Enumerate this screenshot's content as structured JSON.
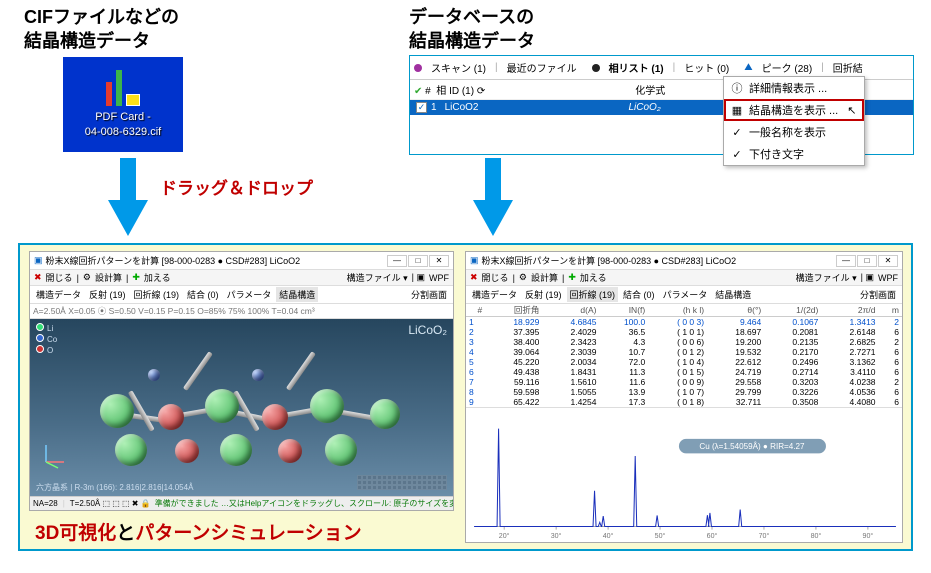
{
  "headings": {
    "cif": [
      "CIFファイルなどの",
      "結晶構造データ"
    ],
    "db": [
      "データベースの",
      "結晶構造データ"
    ]
  },
  "cif_icon": {
    "line1": "PDF Card -",
    "line2": "04-008-6329.cif"
  },
  "drag_drop": "ドラッグ＆ドロップ",
  "db_panel": {
    "tabs": {
      "scan": "スキャン (1)",
      "recent": "最近のファイル",
      "phaselist": "相リスト (1)",
      "hit": "ヒット (0)",
      "peak": "ピーク (28)",
      "diff": "回折結"
    },
    "sub": {
      "phaseid": "相 ID (1)",
      "formula": "化学式"
    },
    "row": {
      "idx": "1",
      "name": "LiCoO2",
      "formula": "LiCoO₂"
    }
  },
  "ctx_menu": {
    "detail": "詳細情報表示 ...",
    "show_struct": "結晶構造を表示 ...",
    "show_name": "一般名称を表示",
    "subscript": "下付き文字"
  },
  "window": {
    "title": "粉末X線回折パターンを計算 [98-000-0283 ● CSD#283] LiCoO2",
    "toolbar": {
      "open": "開じる",
      "save": "設計算",
      "add": "加える",
      "structfile": "構造ファイル ▾",
      "wpf": "WPF"
    },
    "tabs": {
      "struct": "構造データ",
      "refl": "反射 (19)",
      "diff": "回折線 (19)",
      "bond": "結合 (0)",
      "param": "パラメータ",
      "crys": "結晶構造"
    },
    "split": "分割画面",
    "params3d": "A=2.50Å  X=0.05  ⦿ S=0.50  V=0.15  P=0.15  O=85%  75%  100%  T=0.04  cm³",
    "formula": "LiCoO₂",
    "legend": {
      "li": "Li",
      "co": "Co",
      "o": "O"
    },
    "crysinfo": "六方晶系 | R-3m (166): 2.816|2.816|14.054Å",
    "status": {
      "na": "NA=28",
      "t": "T=2.50Å",
      "ready": "準備ができました …又はHelpアイコンをドラッグし、スクロール: 原子のサイズを変更…"
    }
  },
  "refl_table": {
    "headers": [
      "#",
      "回折角",
      "d(A)",
      "IN(f)",
      "(h k l)",
      "θ(°)",
      "1/(2d)",
      "2π/d",
      "m"
    ],
    "rows": [
      [
        "1",
        "18.929",
        "4.6845",
        "100.0",
        "( 0 0 3)",
        "9.464",
        "0.1067",
        "1.3413",
        "2"
      ],
      [
        "2",
        "37.395",
        "2.4029",
        "36.5",
        "( 1 0 1)",
        "18.697",
        "0.2081",
        "2.6148",
        "6"
      ],
      [
        "3",
        "38.400",
        "2.3423",
        "4.3",
        "( 0 0 6)",
        "19.200",
        "0.2135",
        "2.6825",
        "2"
      ],
      [
        "4",
        "39.064",
        "2.3039",
        "10.7",
        "( 0 1 2)",
        "19.532",
        "0.2170",
        "2.7271",
        "6"
      ],
      [
        "5",
        "45.220",
        "2.0034",
        "72.0",
        "( 1 0 4)",
        "22.612",
        "0.2496",
        "3.1362",
        "6"
      ],
      [
        "6",
        "49.438",
        "1.8431",
        "11.3",
        "( 0 1 5)",
        "24.719",
        "0.2714",
        "3.4110",
        "6"
      ],
      [
        "7",
        "59.116",
        "1.5610",
        "11.6",
        "( 0 0 9)",
        "29.558",
        "0.3203",
        "4.0238",
        "2"
      ],
      [
        "8",
        "59.598",
        "1.5055",
        "13.9",
        "( 1 0 7)",
        "29.799",
        "0.3226",
        "4.0536",
        "6"
      ],
      [
        "9",
        "65.422",
        "1.4254",
        "17.3",
        "( 0 1 8)",
        "32.711",
        "0.3508",
        "4.4080",
        "6"
      ]
    ]
  },
  "plot": {
    "annotation": "Cu (λ=1.54059Å) ● RIR=4.27",
    "xticks": [
      "20°",
      "30°",
      "40°",
      "50°",
      "60°",
      "70°",
      "80°",
      "90°"
    ]
  },
  "bottom": {
    "p1": "3D可視化",
    "p2": "と",
    "p3": "パターンシミュレーション"
  }
}
